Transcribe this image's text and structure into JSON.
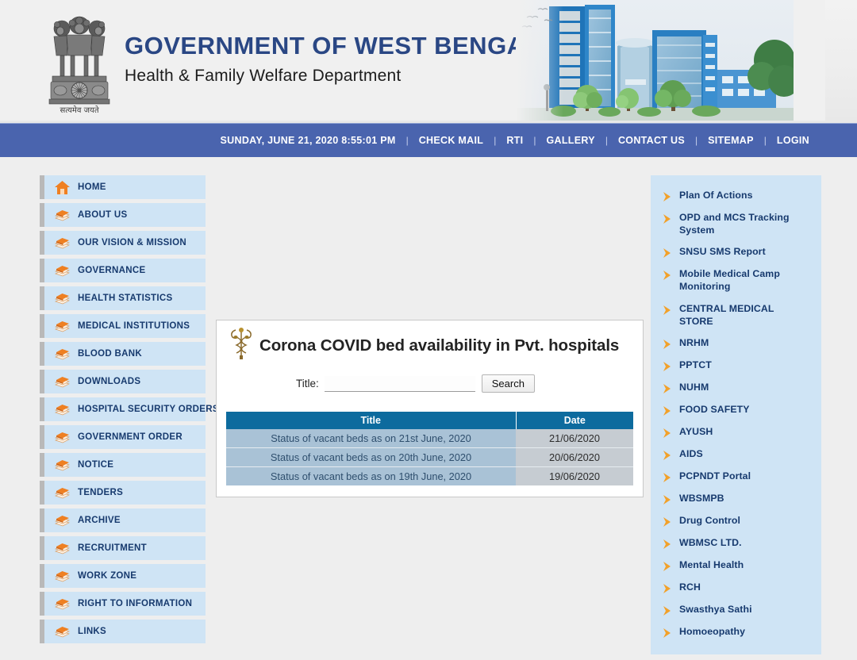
{
  "header": {
    "gov_title": "GOVERNMENT OF WEST BENGAL",
    "dept_title": "Health & Family Welfare Department",
    "emblem_motto": "सत्यमेव जयते"
  },
  "nav": {
    "datetime": "SUNDAY, JUNE 21, 2020 8:55:01 PM",
    "items": [
      {
        "label": "CHECK MAIL"
      },
      {
        "label": "RTI"
      },
      {
        "label": "GALLERY"
      },
      {
        "label": "CONTACT US"
      },
      {
        "label": "SITEMAP"
      },
      {
        "label": "LOGIN"
      }
    ]
  },
  "sidebar": {
    "items": [
      {
        "label": "HOME",
        "icon": "home-icon"
      },
      {
        "label": "ABOUT US",
        "icon": "books-icon"
      },
      {
        "label": "OUR VISION & MISSION",
        "icon": "books-icon"
      },
      {
        "label": "GOVERNANCE",
        "icon": "books-icon"
      },
      {
        "label": "HEALTH STATISTICS",
        "icon": "books-icon"
      },
      {
        "label": "MEDICAL INSTITUTIONS",
        "icon": "books-icon"
      },
      {
        "label": "BLOOD BANK",
        "icon": "books-icon"
      },
      {
        "label": "DOWNLOADS",
        "icon": "books-icon"
      },
      {
        "label": "HOSPITAL SECURITY ORDERS",
        "icon": "books-icon"
      },
      {
        "label": "GOVERNMENT ORDER",
        "icon": "books-icon"
      },
      {
        "label": "NOTICE",
        "icon": "books-icon"
      },
      {
        "label": "TENDERS",
        "icon": "books-icon"
      },
      {
        "label": "ARCHIVE",
        "icon": "books-icon"
      },
      {
        "label": "RECRUITMENT",
        "icon": "books-icon"
      },
      {
        "label": "WORK ZONE",
        "icon": "books-icon"
      },
      {
        "label": "RIGHT TO INFORMATION",
        "icon": "books-icon"
      },
      {
        "label": "LINKS",
        "icon": "books-icon"
      }
    ]
  },
  "main": {
    "page_title": "Corona COVID bed availability in Pvt. hospitals",
    "title_icon": "caduceus-icon",
    "search": {
      "label": "Title:",
      "value": "",
      "placeholder": "",
      "button_label": "Search"
    },
    "table": {
      "columns": [
        "Title",
        "Date"
      ],
      "rows": [
        {
          "title": "Status of vacant beds as on 21st June, 2020",
          "date": "21/06/2020"
        },
        {
          "title": "Status of vacant beds as on 20th June, 2020",
          "date": "20/06/2020"
        },
        {
          "title": "Status of vacant beds as on 19th June, 2020",
          "date": "19/06/2020"
        }
      ]
    }
  },
  "right_panel": {
    "items": [
      {
        "label": "Plan Of Actions"
      },
      {
        "label": "OPD and MCS Tracking System"
      },
      {
        "label": "SNSU SMS Report"
      },
      {
        "label": "Mobile Medical Camp Monitoring"
      },
      {
        "label": "CENTRAL MEDICAL STORE"
      },
      {
        "label": "NRHM"
      },
      {
        "label": "PPTCT"
      },
      {
        "label": "NUHM"
      },
      {
        "label": "FOOD SAFETY"
      },
      {
        "label": "AYUSH"
      },
      {
        "label": "AIDS"
      },
      {
        "label": "PCPNDT Portal"
      },
      {
        "label": "WBSMPB"
      },
      {
        "label": "Drug Control"
      },
      {
        "label": "WBMSC LTD."
      },
      {
        "label": "Mental Health"
      },
      {
        "label": "RCH"
      },
      {
        "label": "Swasthya Sathi"
      },
      {
        "label": "Homoeopathy"
      }
    ]
  },
  "colors": {
    "nav_bar": "#4a64ae",
    "gov_title": "#2a4784",
    "sidebar_bg": "#cfe4f5",
    "sidebar_text": "#173a6e",
    "table_header": "#0d6b9e",
    "table_row_title": "#a9c2d6",
    "table_row_date": "#c6ccd2",
    "accent_orange": "#f39422",
    "page_bg": "#eeeeee"
  }
}
